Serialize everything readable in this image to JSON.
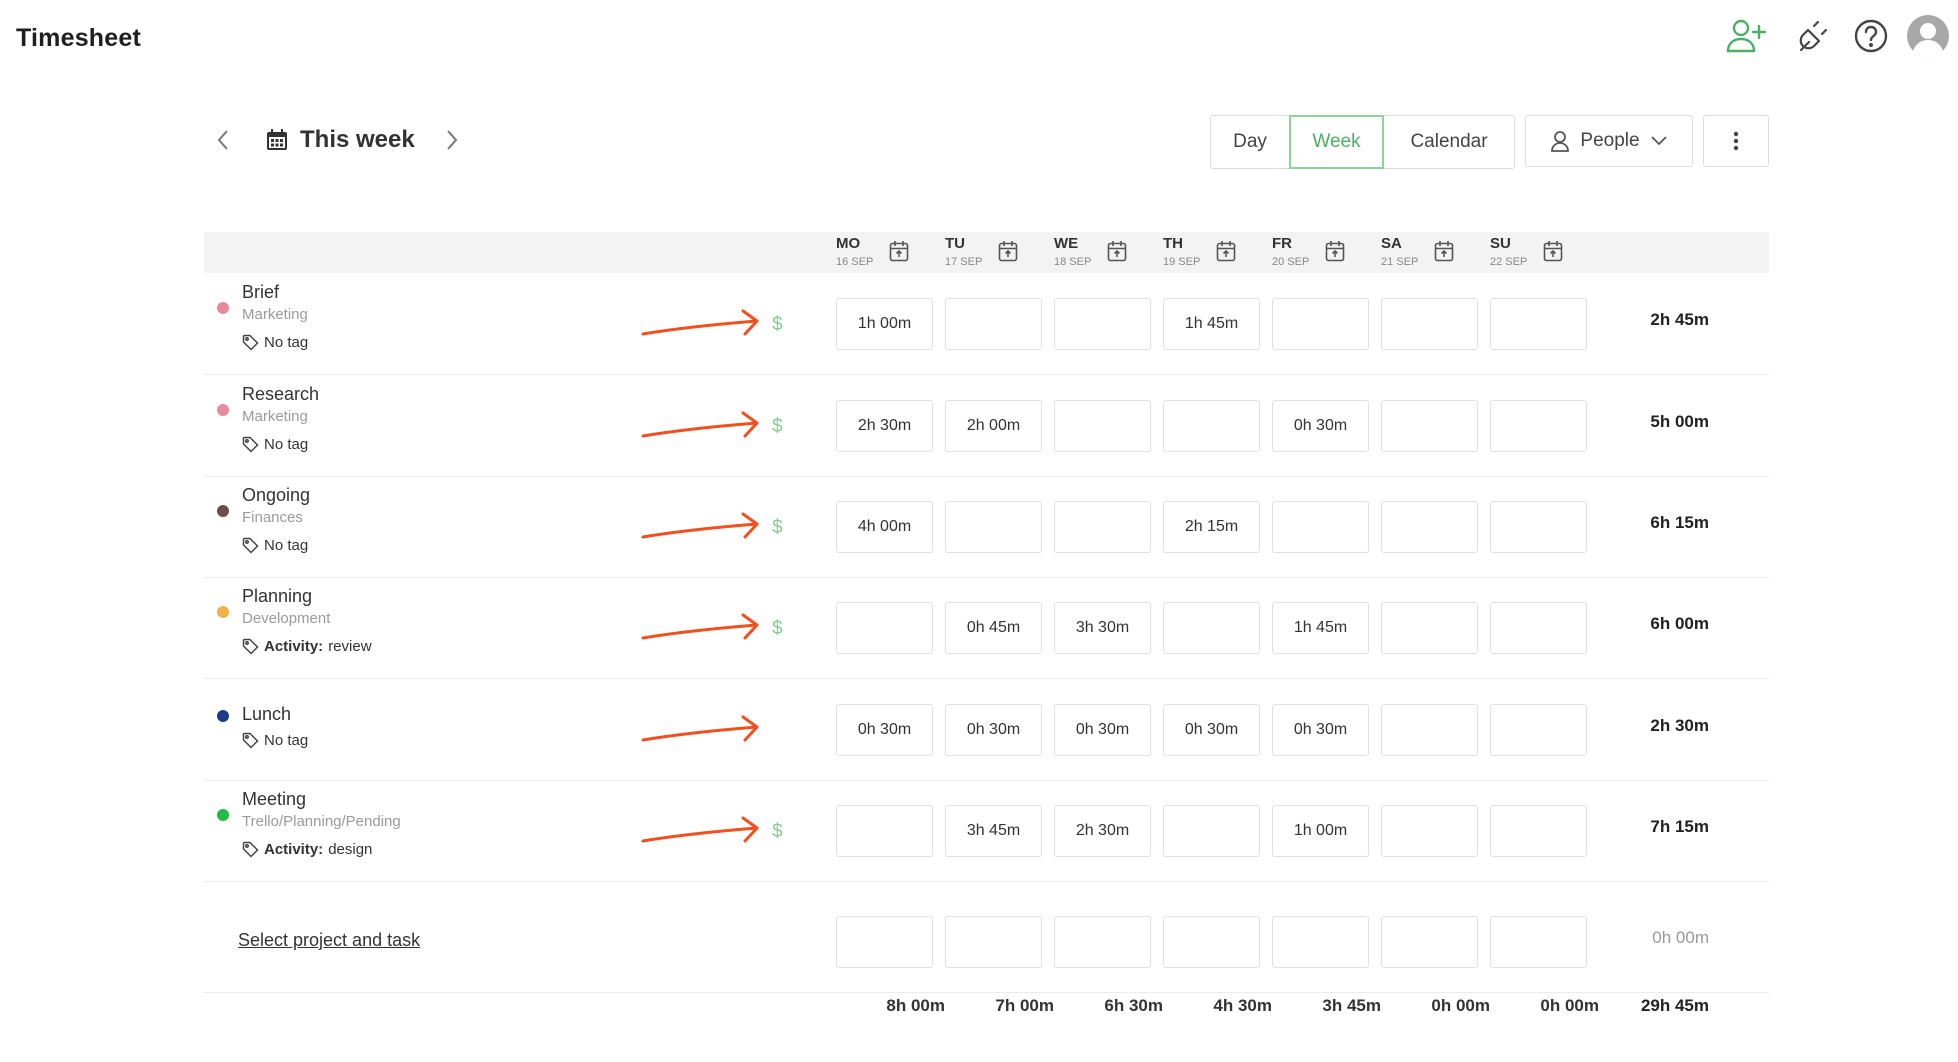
{
  "app": {
    "title": "Timesheet"
  },
  "header_icons": [
    "add-user-icon",
    "plug-icon",
    "help-icon",
    "avatar"
  ],
  "week_nav": {
    "label": "This week"
  },
  "views": {
    "day": "Day",
    "week": "Week",
    "calendar": "Calendar",
    "active": "Week"
  },
  "people": {
    "label": "People"
  },
  "days": [
    {
      "abbr": "MO",
      "date": "16 SEP"
    },
    {
      "abbr": "TU",
      "date": "17 SEP"
    },
    {
      "abbr": "WE",
      "date": "18 SEP"
    },
    {
      "abbr": "TH",
      "date": "19 SEP"
    },
    {
      "abbr": "FR",
      "date": "20 SEP"
    },
    {
      "abbr": "SA",
      "date": "21 SEP"
    },
    {
      "abbr": "SU",
      "date": "22 SEP"
    }
  ],
  "rows": [
    {
      "task": "Brief",
      "project": "Marketing",
      "tag_prefix": "",
      "tag_value": "No tag",
      "color": "#e88a9a",
      "billable": "$",
      "hours": [
        "1h 00m",
        "",
        "",
        "1h 45m",
        "",
        "",
        ""
      ],
      "total": "2h 45m"
    },
    {
      "task": "Research",
      "project": "Marketing",
      "tag_prefix": "",
      "tag_value": "No tag",
      "color": "#e88a9a",
      "billable": "$",
      "hours": [
        "2h 30m",
        "2h 00m",
        "",
        "",
        "0h 30m",
        "",
        ""
      ],
      "total": "5h 00m"
    },
    {
      "task": "Ongoing",
      "project": "Finances",
      "tag_prefix": "",
      "tag_value": "No tag",
      "color": "#6a4d4d",
      "billable": "$",
      "hours": [
        "4h 00m",
        "",
        "",
        "2h 15m",
        "",
        "",
        ""
      ],
      "total": "6h 15m"
    },
    {
      "task": "Planning",
      "project": "Development",
      "tag_prefix": "Activity:",
      "tag_value": "review",
      "color": "#f0b04a",
      "billable": "$",
      "hours": [
        "",
        "0h 45m",
        "3h 30m",
        "",
        "1h 45m",
        "",
        ""
      ],
      "total": "6h 00m"
    },
    {
      "task": "Lunch",
      "project": "",
      "tag_prefix": "",
      "tag_value": "No tag",
      "color": "#1e3a8a",
      "billable": "",
      "hours": [
        "0h 30m",
        "0h 30m",
        "0h 30m",
        "0h 30m",
        "0h 30m",
        "",
        ""
      ],
      "total": "2h 30m"
    },
    {
      "task": "Meeting",
      "project": "Trello/Planning/Pending",
      "tag_prefix": "Activity:",
      "tag_value": "design",
      "color": "#22bb44",
      "billable": "$",
      "hours": [
        "",
        "3h 45m",
        "2h 30m",
        "",
        "1h 00m",
        "",
        ""
      ],
      "total": "7h 15m"
    }
  ],
  "new_row": {
    "label": "Select project and task",
    "total": "0h 00m"
  },
  "day_totals": [
    "8h 00m",
    "7h 00m",
    "6h 30m",
    "4h 30m",
    "3h 45m",
    "0h 00m",
    "0h 00m"
  ],
  "grand_total": "29h 45m",
  "colors": {
    "accent": "#4caf65",
    "arrow": "#f0501e"
  }
}
